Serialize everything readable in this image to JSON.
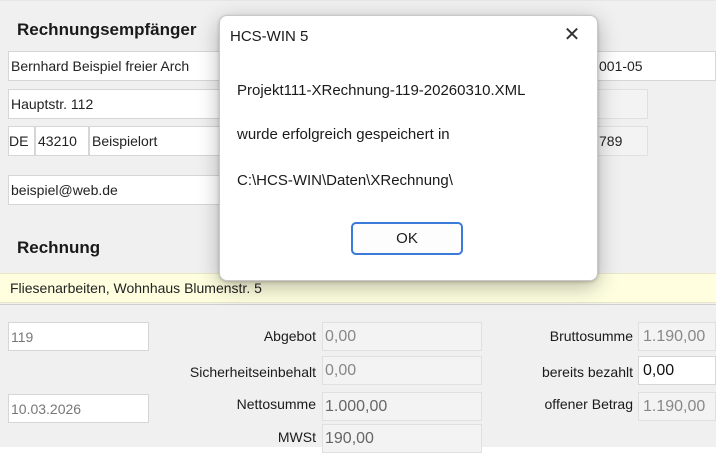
{
  "recipient": {
    "title": "Rechnungsempfänger",
    "name": "Bernhard Beispiel freier Arch",
    "street": "Hauptstr. 112",
    "country": "DE",
    "zip": "43210",
    "city": "Beispielort",
    "email": "beispiel@web.de",
    "right_value": "001-05",
    "right_phone": "789"
  },
  "invoice": {
    "title": "Rechnung",
    "subject": "Fliesenarbeiten, Wohnhaus Blumenstr. 5",
    "number": "119",
    "date": "10.03.2026",
    "labels": {
      "abgebot": "Abgebot",
      "sicherheit": "Sicherheitseinbehalt",
      "netto": "Nettosumme",
      "mwst": "MWSt",
      "brutto": "Bruttosumme",
      "bezahlt": "bereits bezahlt",
      "offen": "offener Betrag"
    },
    "values": {
      "abgebot": "0,00",
      "sicherheit": "0,00",
      "netto": "1.000,00",
      "mwst": "190,00",
      "brutto": "1.190,00",
      "bezahlt": "0,00",
      "offen": "1.190,00"
    }
  },
  "dialog": {
    "title": "HCS-WIN 5",
    "close_symbol": "✕",
    "line1": "Projekt111-XRechnung-119-20260310.XML",
    "line2": "wurde erfolgreich gespeichert in",
    "line3": "C:\\HCS-WIN\\Daten\\XRechnung\\",
    "ok_label": "OK"
  }
}
